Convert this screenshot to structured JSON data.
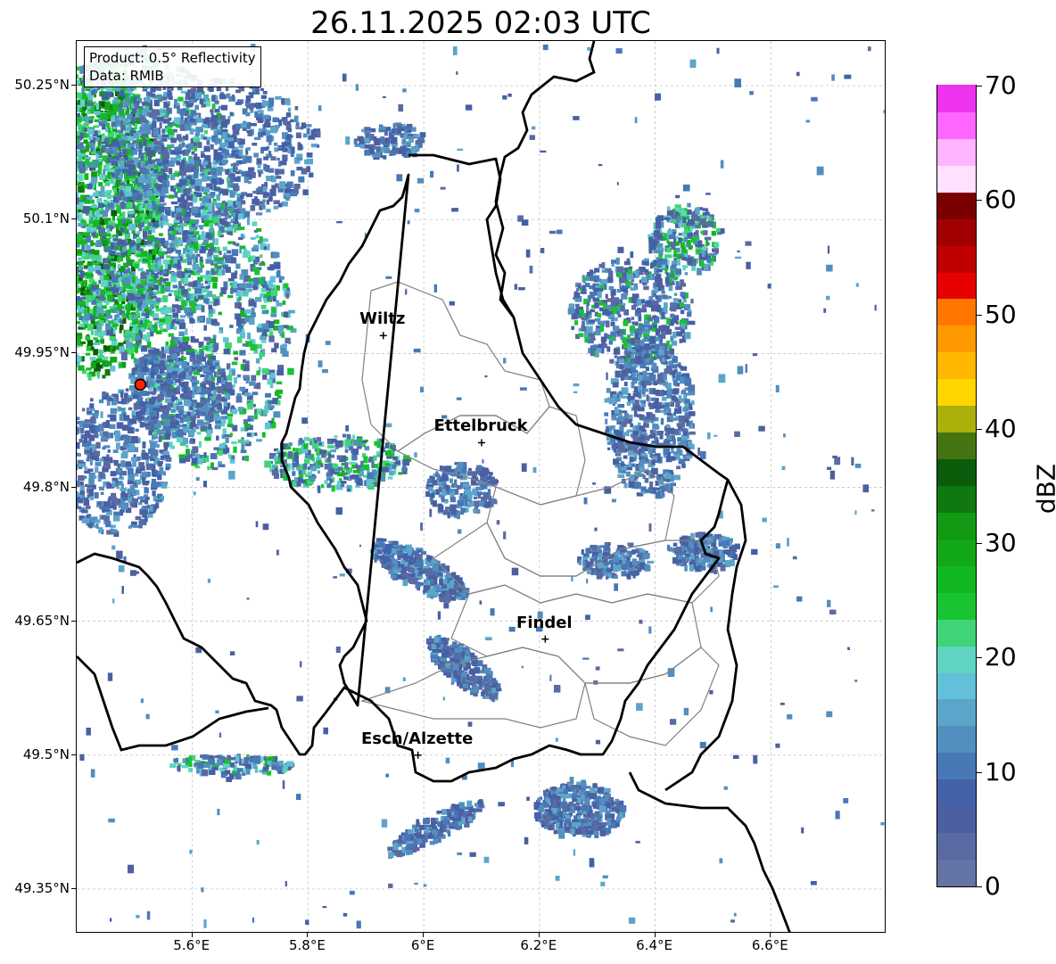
{
  "title": "26.11.2025 02:03 UTC",
  "info": {
    "product": "Product: 0.5° Reflectivity",
    "data": "Data: RMIB"
  },
  "axes": {
    "y_ticks": [
      "50.25°N",
      "50.1°N",
      "49.95°N",
      "49.8°N",
      "49.65°N",
      "49.5°N",
      "49.35°N"
    ],
    "x_ticks": [
      "5.6°E",
      "5.8°E",
      "6°E",
      "6.2°E",
      "6.4°E",
      "6.6°E"
    ],
    "lon_range": [
      5.4,
      6.8
    ],
    "lat_range": [
      49.3,
      50.3
    ],
    "grid": true
  },
  "cities": [
    {
      "name": "Wiltz",
      "lon": 5.93,
      "lat": 49.97
    },
    {
      "name": "Ettelbruck",
      "lon": 6.1,
      "lat": 49.85
    },
    {
      "name": "Findel",
      "lon": 6.21,
      "lat": 49.63
    },
    {
      "name": "Esch/Alzette",
      "lon": 5.99,
      "lat": 49.5
    }
  ],
  "radar_site": {
    "lon": 5.51,
    "lat": 49.915,
    "color": "#ff2200"
  },
  "colorbar": {
    "unit": "dBZ",
    "min": 0,
    "max": 70,
    "step": 2.5,
    "tick_labels": [
      "0",
      "10",
      "20",
      "30",
      "40",
      "50",
      "60",
      "70"
    ],
    "colors": [
      "#6474a6",
      "#5a6aa2",
      "#4c5fa0",
      "#4361a8",
      "#4878b5",
      "#528ebe",
      "#5ba5cb",
      "#62c0d8",
      "#5ed5c0",
      "#40d476",
      "#18c432",
      "#12b822",
      "#12a818",
      "#129a14",
      "#107810",
      "#0a5c0a",
      "#467410",
      "#acb00a",
      "#ffd600",
      "#ffb700",
      "#ff9900",
      "#ff7700",
      "#e60000",
      "#c00000",
      "#a10000",
      "#7a0000",
      "#ffe0ff",
      "#ffb4ff",
      "#ff66ff",
      "#ee33ee"
    ]
  }
}
